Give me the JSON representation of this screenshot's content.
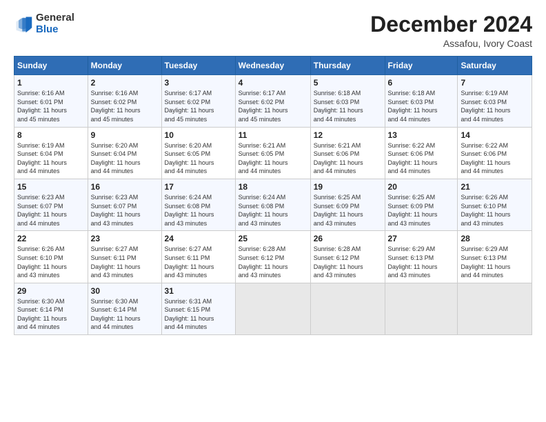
{
  "logo": {
    "general": "General",
    "blue": "Blue"
  },
  "header": {
    "month": "December 2024",
    "location": "Assafou, Ivory Coast"
  },
  "days": [
    "Sunday",
    "Monday",
    "Tuesday",
    "Wednesday",
    "Thursday",
    "Friday",
    "Saturday"
  ],
  "weeks": [
    [
      {
        "day": 1,
        "sunrise": "6:16 AM",
        "sunset": "6:01 PM",
        "daylight": "11 hours and 45 minutes."
      },
      {
        "day": 2,
        "sunrise": "6:16 AM",
        "sunset": "6:02 PM",
        "daylight": "11 hours and 45 minutes."
      },
      {
        "day": 3,
        "sunrise": "6:17 AM",
        "sunset": "6:02 PM",
        "daylight": "11 hours and 45 minutes."
      },
      {
        "day": 4,
        "sunrise": "6:17 AM",
        "sunset": "6:02 PM",
        "daylight": "11 hours and 45 minutes."
      },
      {
        "day": 5,
        "sunrise": "6:18 AM",
        "sunset": "6:03 PM",
        "daylight": "11 hours and 44 minutes."
      },
      {
        "day": 6,
        "sunrise": "6:18 AM",
        "sunset": "6:03 PM",
        "daylight": "11 hours and 44 minutes."
      },
      {
        "day": 7,
        "sunrise": "6:19 AM",
        "sunset": "6:03 PM",
        "daylight": "11 hours and 44 minutes."
      }
    ],
    [
      {
        "day": 8,
        "sunrise": "6:19 AM",
        "sunset": "6:04 PM",
        "daylight": "11 hours and 44 minutes."
      },
      {
        "day": 9,
        "sunrise": "6:20 AM",
        "sunset": "6:04 PM",
        "daylight": "11 hours and 44 minutes."
      },
      {
        "day": 10,
        "sunrise": "6:20 AM",
        "sunset": "6:05 PM",
        "daylight": "11 hours and 44 minutes."
      },
      {
        "day": 11,
        "sunrise": "6:21 AM",
        "sunset": "6:05 PM",
        "daylight": "11 hours and 44 minutes."
      },
      {
        "day": 12,
        "sunrise": "6:21 AM",
        "sunset": "6:06 PM",
        "daylight": "11 hours and 44 minutes."
      },
      {
        "day": 13,
        "sunrise": "6:22 AM",
        "sunset": "6:06 PM",
        "daylight": "11 hours and 44 minutes."
      },
      {
        "day": 14,
        "sunrise": "6:22 AM",
        "sunset": "6:06 PM",
        "daylight": "11 hours and 44 minutes."
      }
    ],
    [
      {
        "day": 15,
        "sunrise": "6:23 AM",
        "sunset": "6:07 PM",
        "daylight": "11 hours and 44 minutes."
      },
      {
        "day": 16,
        "sunrise": "6:23 AM",
        "sunset": "6:07 PM",
        "daylight": "11 hours and 43 minutes."
      },
      {
        "day": 17,
        "sunrise": "6:24 AM",
        "sunset": "6:08 PM",
        "daylight": "11 hours and 43 minutes."
      },
      {
        "day": 18,
        "sunrise": "6:24 AM",
        "sunset": "6:08 PM",
        "daylight": "11 hours and 43 minutes."
      },
      {
        "day": 19,
        "sunrise": "6:25 AM",
        "sunset": "6:09 PM",
        "daylight": "11 hours and 43 minutes."
      },
      {
        "day": 20,
        "sunrise": "6:25 AM",
        "sunset": "6:09 PM",
        "daylight": "11 hours and 43 minutes."
      },
      {
        "day": 21,
        "sunrise": "6:26 AM",
        "sunset": "6:10 PM",
        "daylight": "11 hours and 43 minutes."
      }
    ],
    [
      {
        "day": 22,
        "sunrise": "6:26 AM",
        "sunset": "6:10 PM",
        "daylight": "11 hours and 43 minutes."
      },
      {
        "day": 23,
        "sunrise": "6:27 AM",
        "sunset": "6:11 PM",
        "daylight": "11 hours and 43 minutes."
      },
      {
        "day": 24,
        "sunrise": "6:27 AM",
        "sunset": "6:11 PM",
        "daylight": "11 hours and 43 minutes."
      },
      {
        "day": 25,
        "sunrise": "6:28 AM",
        "sunset": "6:12 PM",
        "daylight": "11 hours and 43 minutes."
      },
      {
        "day": 26,
        "sunrise": "6:28 AM",
        "sunset": "6:12 PM",
        "daylight": "11 hours and 43 minutes."
      },
      {
        "day": 27,
        "sunrise": "6:29 AM",
        "sunset": "6:13 PM",
        "daylight": "11 hours and 43 minutes."
      },
      {
        "day": 28,
        "sunrise": "6:29 AM",
        "sunset": "6:13 PM",
        "daylight": "11 hours and 44 minutes."
      }
    ],
    [
      {
        "day": 29,
        "sunrise": "6:30 AM",
        "sunset": "6:14 PM",
        "daylight": "11 hours and 44 minutes."
      },
      {
        "day": 30,
        "sunrise": "6:30 AM",
        "sunset": "6:14 PM",
        "daylight": "11 hours and 44 minutes."
      },
      {
        "day": 31,
        "sunrise": "6:31 AM",
        "sunset": "6:15 PM",
        "daylight": "11 hours and 44 minutes."
      },
      null,
      null,
      null,
      null
    ]
  ]
}
